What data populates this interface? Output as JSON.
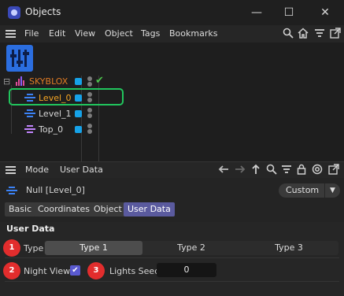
{
  "window": {
    "title": "Objects",
    "minimize_glyph": "—",
    "maximize_glyph": "☐",
    "close_glyph": "✕"
  },
  "menu": {
    "items": [
      "File",
      "Edit",
      "View",
      "Object",
      "Tags",
      "Bookmarks"
    ]
  },
  "menu_icons": [
    "search-icon",
    "home-icon",
    "filter-icon",
    "expand-icon"
  ],
  "tree": {
    "root": {
      "label": "SKYBLOX",
      "color": "#e07b24"
    },
    "children": [
      {
        "label": "Level_0",
        "color": "#f5a623",
        "selected": true
      },
      {
        "label": "Level_1",
        "color": "#d6d6d6"
      },
      {
        "label": "Top_0",
        "color": "#d6d6d6"
      }
    ],
    "collapse_glyph": "⊟",
    "check_glyph": "✔"
  },
  "attributes": {
    "bar": {
      "mode_label": "Mode",
      "userdata_label": "User Data"
    },
    "object_title": "Null [Level_0]",
    "custom_label": "Custom",
    "chevron_glyph": "▼",
    "tabs": [
      {
        "label": "Basic",
        "active": false
      },
      {
        "label": "Coordinates",
        "active": false
      },
      {
        "label": "Object",
        "active": false
      },
      {
        "label": "User Data",
        "active": true
      }
    ],
    "section_title": "User Data",
    "type": {
      "label": "Type",
      "options": [
        "Type 1",
        "Type 2",
        "Type 3"
      ],
      "selected": "Type 1"
    },
    "night_view": {
      "label": "Night View",
      "checked": true,
      "check_glyph": "✔"
    },
    "lights_seed": {
      "label": "Lights Seed",
      "value": "0"
    }
  },
  "badges": [
    "1",
    "2",
    "3"
  ],
  "colors": {
    "accent": "#5a5a9e",
    "selection_outline": "#21c55d",
    "badge": "#e22d2d",
    "layer_button": "#2b6ee0",
    "tag_square": "#16a2e8"
  }
}
